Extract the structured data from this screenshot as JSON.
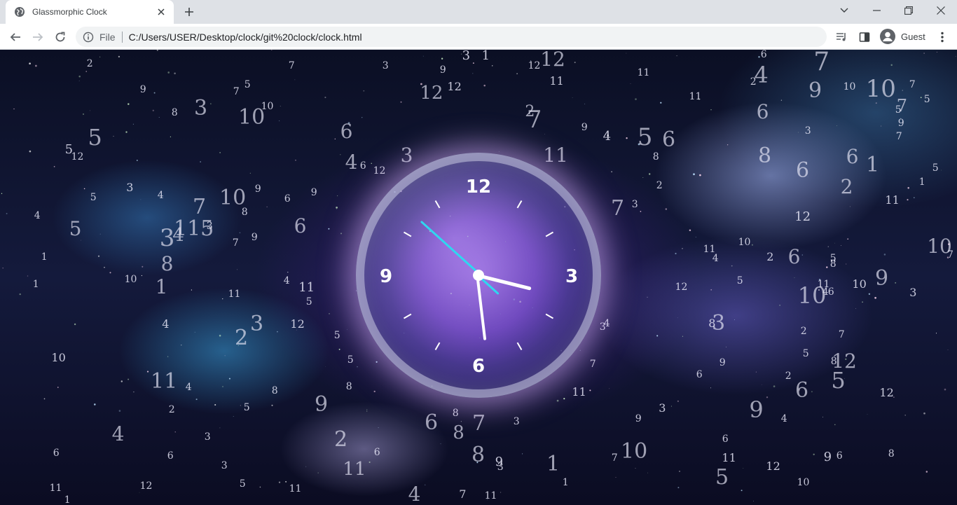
{
  "browser": {
    "tab_title": "Glassmorphic Clock",
    "scheme": "File",
    "url": "C:/Users/USER/Desktop/clock/git%20clock/clock.html",
    "profile": "Guest"
  },
  "clock": {
    "label_12": "12",
    "label_3": "3",
    "label_6": "6",
    "label_9": "9",
    "time": {
      "hour": 3,
      "minute": 28,
      "second": 52
    }
  },
  "floating_numbers": [
    [
      "2",
      128,
      91,
      14
    ],
    [
      "7",
      416,
      94,
      14
    ],
    [
      "3",
      550,
      94,
      14
    ],
    [
      "9",
      632,
      100,
      14
    ],
    [
      "3",
      665,
      80,
      18
    ],
    [
      "1",
      693,
      76,
      18
    ],
    [
      "12",
      788,
      77,
      28
    ],
    [
      "6",
      1090,
      76,
      14
    ],
    [
      "7",
      1172,
      85,
      36
    ],
    [
      "12",
      762,
      94,
      14
    ],
    [
      "11",
      794,
      116,
      16
    ],
    [
      "11",
      918,
      104,
      14
    ],
    [
      "4",
      1086,
      107,
      32
    ],
    [
      "2",
      1075,
      117,
      14
    ],
    [
      "9",
      1163,
      130,
      30
    ],
    [
      "10",
      1212,
      124,
      14
    ],
    [
      "10",
      1256,
      127,
      34
    ],
    [
      "7",
      1302,
      121,
      14
    ],
    [
      "5",
      1323,
      142,
      14
    ],
    [
      "9",
      204,
      128,
      14
    ],
    [
      "5",
      353,
      121,
      14
    ],
    [
      "7",
      337,
      131,
      14
    ],
    [
      "10",
      381,
      152,
      14
    ],
    [
      "12",
      615,
      133,
      26
    ],
    [
      "12",
      648,
      124,
      16
    ],
    [
      "11",
      992,
      138,
      14
    ],
    [
      "7",
      1287,
      151,
      24
    ],
    [
      "5",
      1282,
      157,
      14
    ],
    [
      "9",
      1286,
      176,
      14
    ],
    [
      "7",
      1283,
      195,
      14
    ],
    [
      "3",
      286,
      155,
      30
    ],
    [
      "8",
      249,
      161,
      14
    ],
    [
      "10",
      358,
      168,
      30
    ],
    [
      "2",
      756,
      160,
      22
    ],
    [
      "7",
      762,
      171,
      34
    ],
    [
      "9",
      834,
      182,
      14
    ],
    [
      "6",
      1088,
      160,
      28
    ],
    [
      "3",
      1153,
      187,
      14
    ],
    [
      "5",
      135,
      196,
      32
    ],
    [
      "6",
      494,
      188,
      28
    ],
    [
      "4",
      866,
      195,
      18
    ],
    [
      "5",
      920,
      196,
      34
    ],
    [
      "6",
      954,
      200,
      30
    ],
    [
      "8",
      936,
      224,
      14
    ],
    [
      "5",
      98,
      214,
      18
    ],
    [
      "12",
      110,
      224,
      14
    ],
    [
      "3",
      580,
      222,
      28
    ],
    [
      "11",
      792,
      222,
      28
    ],
    [
      "8",
      1091,
      223,
      30
    ],
    [
      "6",
      1216,
      224,
      28
    ],
    [
      "1",
      1245,
      236,
      30
    ],
    [
      "6",
      1145,
      244,
      30
    ],
    [
      "5",
      1335,
      240,
      14
    ],
    [
      "4",
      501,
      232,
      28
    ],
    [
      "6",
      518,
      237,
      14
    ],
    [
      "12",
      541,
      244,
      14
    ],
    [
      "1",
      1316,
      260,
      14
    ],
    [
      "2",
      941,
      265,
      14
    ],
    [
      "2",
      1208,
      267,
      28
    ],
    [
      "3",
      185,
      268,
      16
    ],
    [
      "4",
      229,
      279,
      14
    ],
    [
      "5",
      133,
      282,
      14
    ],
    [
      "9",
      368,
      270,
      14
    ],
    [
      "9",
      448,
      275,
      14
    ],
    [
      "10",
      331,
      283,
      30
    ],
    [
      "6",
      410,
      284,
      14
    ],
    [
      "7",
      284,
      296,
      30
    ],
    [
      "8",
      349,
      303,
      14
    ],
    [
      "7",
      881,
      298,
      30
    ],
    [
      "3",
      906,
      292,
      14
    ],
    [
      "11",
      1273,
      286,
      16
    ],
    [
      "4",
      53,
      308,
      14
    ],
    [
      "5",
      107,
      327,
      28
    ],
    [
      "115",
      275,
      327,
      30
    ],
    [
      "3",
      299,
      323,
      14
    ],
    [
      "6",
      428,
      323,
      28
    ],
    [
      "12",
      1145,
      310,
      18
    ],
    [
      "3",
      238,
      340,
      34
    ],
    [
      "4",
      254,
      336,
      26
    ],
    [
      "9",
      363,
      339,
      14
    ],
    [
      "7",
      336,
      347,
      14
    ],
    [
      "10",
      1062,
      346,
      14
    ],
    [
      "11",
      1012,
      356,
      14
    ],
    [
      "4",
      1021,
      369,
      14
    ],
    [
      "2",
      1099,
      367,
      16
    ],
    [
      "6",
      1133,
      367,
      28
    ],
    [
      "5",
      1189,
      369,
      14
    ],
    [
      "8",
      1189,
      377,
      14
    ],
    [
      "10",
      1340,
      352,
      28
    ],
    [
      "7",
      1362,
      364,
      14
    ],
    [
      "1",
      63,
      367,
      14
    ],
    [
      "8",
      238,
      377,
      28
    ],
    [
      "1",
      51,
      406,
      14
    ],
    [
      "10",
      186,
      399,
      14
    ],
    [
      "4",
      409,
      401,
      14
    ],
    [
      "1",
      230,
      410,
      28
    ],
    [
      "11",
      437,
      411,
      18
    ],
    [
      "5",
      1056,
      401,
      14
    ],
    [
      "9",
      1258,
      398,
      30
    ],
    [
      "10",
      1226,
      406,
      16
    ],
    [
      "11",
      1175,
      406,
      14
    ],
    [
      "4",
      1178,
      417,
      14
    ],
    [
      "6",
      1186,
      417,
      14
    ],
    [
      "3",
      1303,
      418,
      16
    ],
    [
      "11",
      334,
      420,
      14
    ],
    [
      "5",
      441,
      431,
      14
    ],
    [
      "12",
      972,
      410,
      14
    ],
    [
      "10",
      1158,
      422,
      32
    ],
    [
      "4",
      236,
      463,
      16
    ],
    [
      "12",
      424,
      463,
      16
    ],
    [
      "3",
      366,
      463,
      30
    ],
    [
      "2",
      344,
      483,
      30
    ],
    [
      "3",
      860,
      467,
      14
    ],
    [
      "4",
      866,
      462,
      14
    ],
    [
      "8",
      1016,
      462,
      16
    ],
    [
      "3",
      1025,
      462,
      30
    ],
    [
      "2",
      1147,
      473,
      14
    ],
    [
      "7",
      1201,
      478,
      14
    ],
    [
      "5",
      481,
      479,
      14
    ],
    [
      "10",
      83,
      511,
      16
    ],
    [
      "5",
      500,
      514,
      14
    ],
    [
      "9",
      1031,
      518,
      14
    ],
    [
      "5",
      1150,
      505,
      14
    ],
    [
      "8",
      1190,
      516,
      14
    ],
    [
      "12",
      1204,
      516,
      28
    ],
    [
      "7",
      846,
      520,
      14
    ],
    [
      "11",
      233,
      545,
      30
    ],
    [
      "4",
      269,
      553,
      14
    ],
    [
      "6",
      998,
      535,
      14
    ],
    [
      "2",
      1125,
      537,
      14
    ],
    [
      "5",
      1196,
      543,
      32
    ],
    [
      "6",
      1144,
      558,
      30
    ],
    [
      "8",
      498,
      552,
      14
    ],
    [
      "8",
      392,
      558,
      14
    ],
    [
      "11",
      826,
      560,
      16
    ],
    [
      "12",
      1265,
      561,
      16
    ],
    [
      "9",
      458,
      578,
      30
    ],
    [
      "2",
      245,
      585,
      14
    ],
    [
      "5",
      352,
      582,
      14
    ],
    [
      "3",
      945,
      583,
      16
    ],
    [
      "9",
      1079,
      585,
      32
    ],
    [
      "8",
      650,
      590,
      14
    ],
    [
      "6",
      615,
      604,
      30
    ],
    [
      "8",
      654,
      618,
      26
    ],
    [
      "7",
      683,
      605,
      30
    ],
    [
      "3",
      737,
      602,
      14
    ],
    [
      "4",
      1119,
      598,
      14
    ],
    [
      "9",
      911,
      598,
      14
    ],
    [
      "4",
      168,
      620,
      28
    ],
    [
      "3",
      296,
      624,
      14
    ],
    [
      "2",
      486,
      628,
      30
    ],
    [
      "6",
      80,
      647,
      14
    ],
    [
      "6",
      243,
      651,
      14
    ],
    [
      "6",
      538,
      646,
      14
    ],
    [
      "8",
      682,
      650,
      30
    ],
    [
      "9",
      712,
      660,
      18
    ],
    [
      "3",
      714,
      667,
      14
    ],
    [
      "1",
      789,
      663,
      30
    ],
    [
      "6",
      1035,
      627,
      14
    ],
    [
      "11",
      1040,
      654,
      16
    ],
    [
      "10",
      904,
      645,
      30
    ],
    [
      "7",
      877,
      654,
      14
    ],
    [
      "9",
      1181,
      653,
      18
    ],
    [
      "6",
      1198,
      651,
      14
    ],
    [
      "8",
      1272,
      648,
      14
    ],
    [
      "11",
      505,
      670,
      26
    ],
    [
      "3",
      320,
      665,
      14
    ],
    [
      "12",
      1103,
      666,
      16
    ],
    [
      "5",
      1030,
      682,
      30
    ],
    [
      "1",
      807,
      689,
      14
    ],
    [
      "10",
      1146,
      689,
      14
    ],
    [
      "11",
      79,
      697,
      14
    ],
    [
      "12",
      208,
      694,
      14
    ],
    [
      "5",
      346,
      691,
      14
    ],
    [
      "11",
      421,
      698,
      14
    ],
    [
      "4",
      591,
      706,
      28
    ],
    [
      "7",
      660,
      706,
      16
    ],
    [
      "11",
      700,
      708,
      14
    ],
    [
      "1",
      96,
      714,
      14
    ]
  ]
}
